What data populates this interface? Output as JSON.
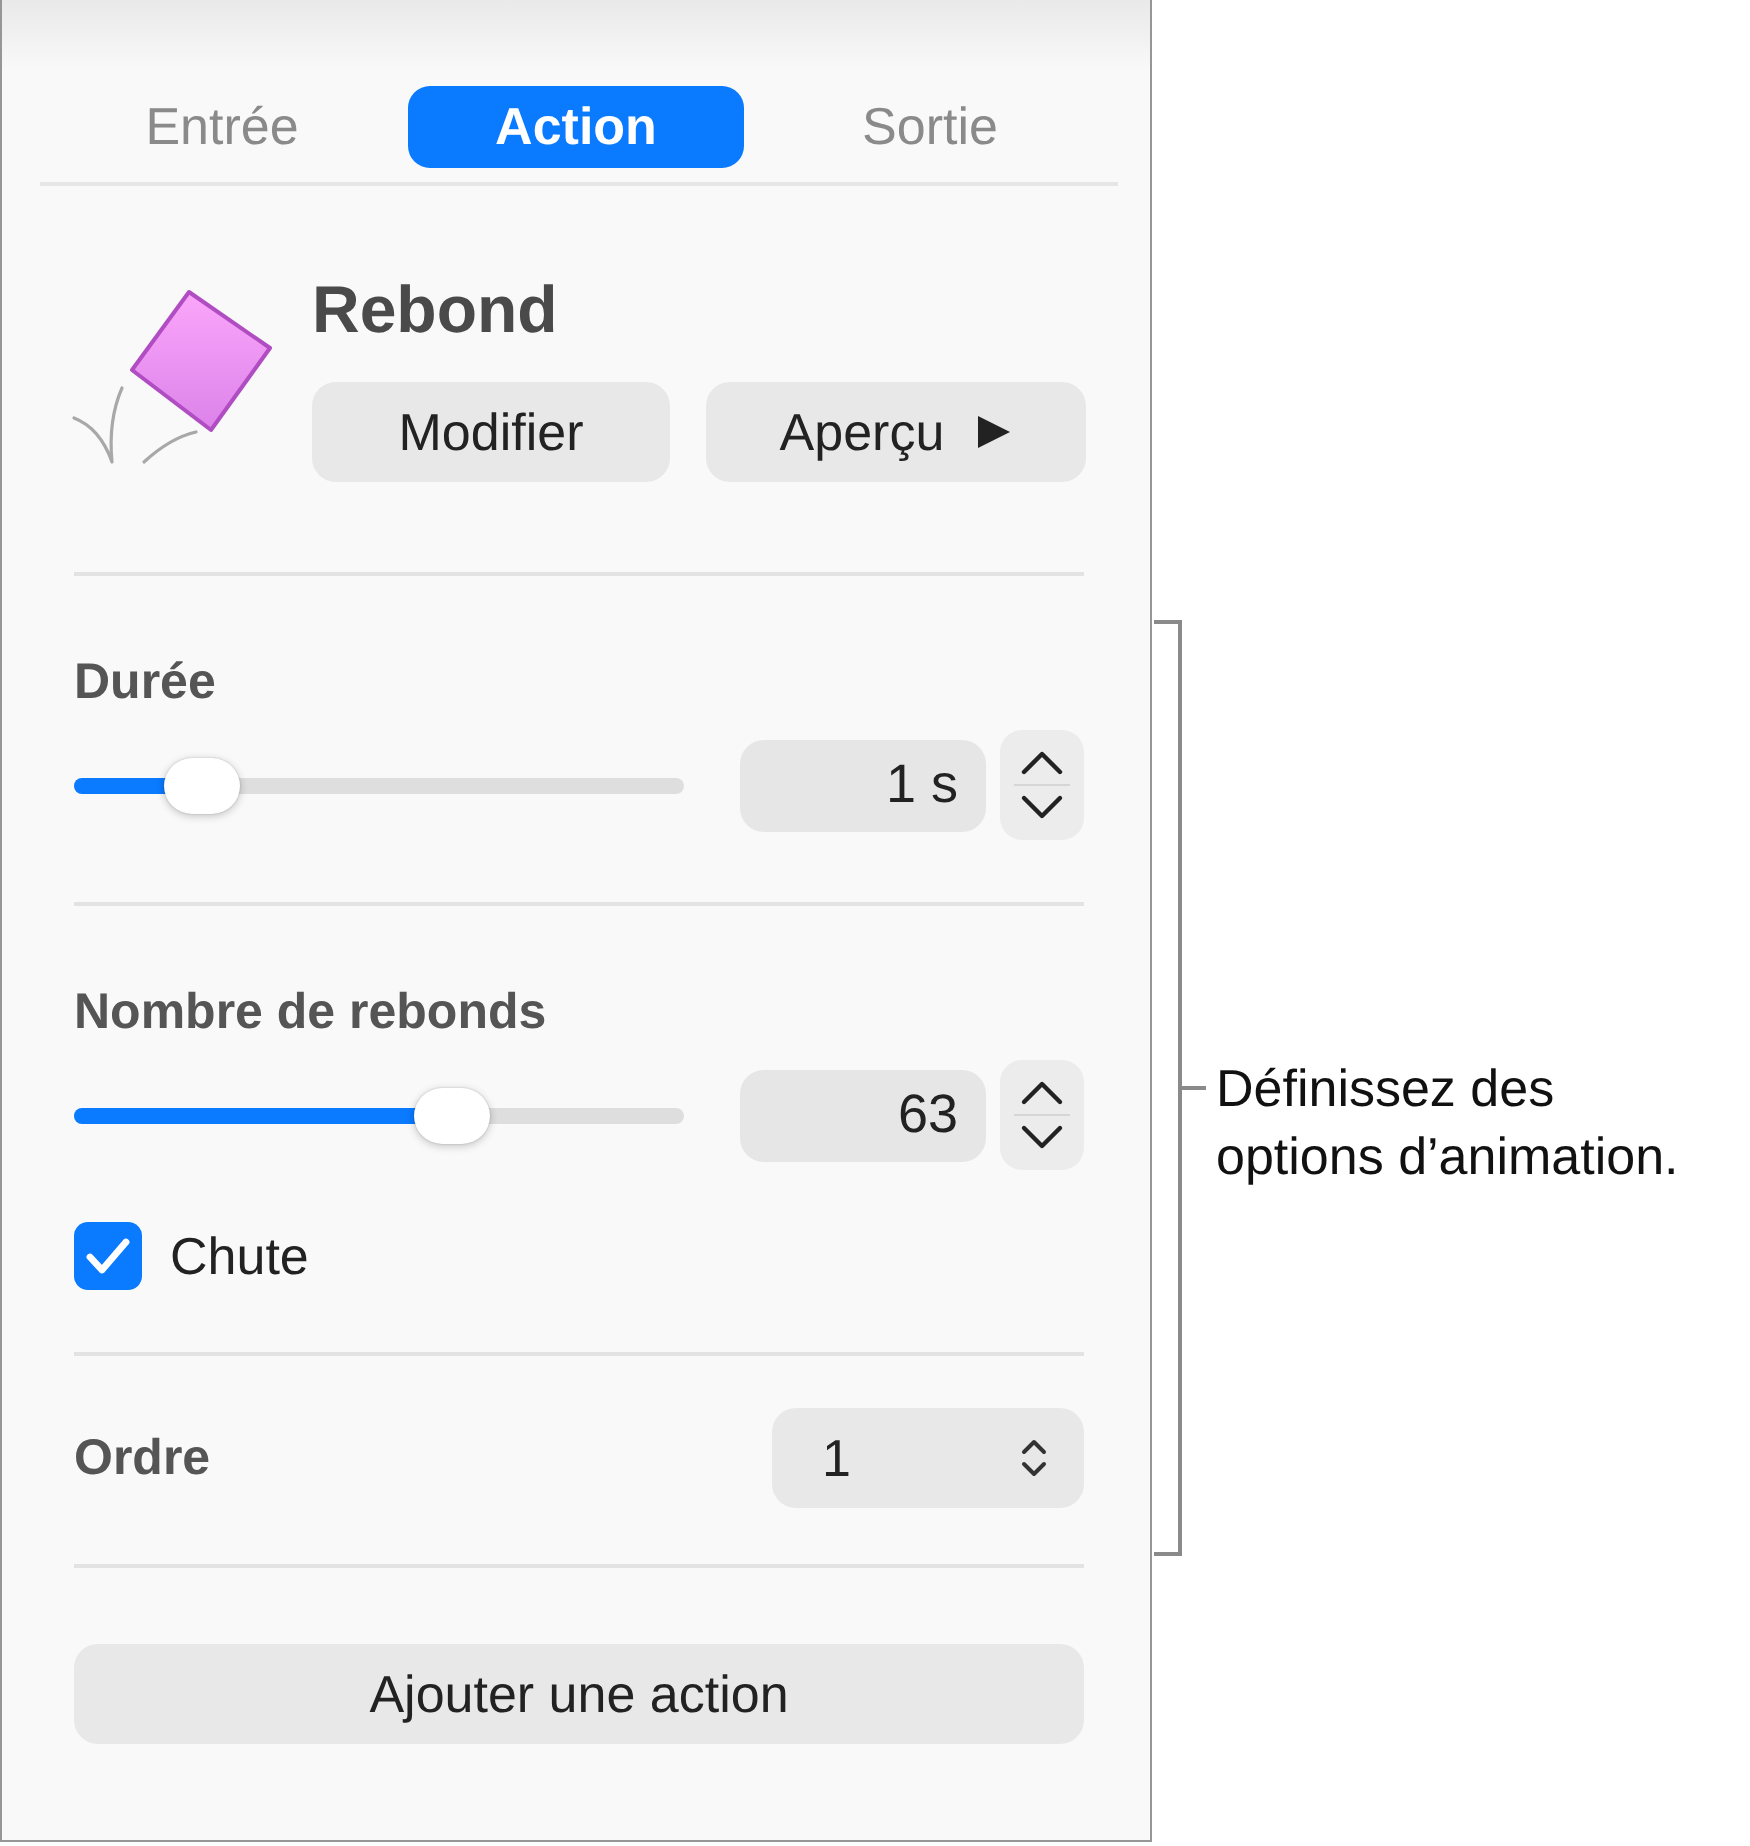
{
  "tabs": [
    {
      "label": "Entrée",
      "selected": false
    },
    {
      "label": "Action",
      "selected": true
    },
    {
      "label": "Sortie",
      "selected": false
    }
  ],
  "effect": {
    "name": "Rebond",
    "buttons": [
      {
        "label": "Modifier",
        "kind": "text"
      },
      {
        "label": "Aperçu",
        "kind": "play"
      }
    ]
  },
  "sections": [
    {
      "kind": "slider",
      "label": "Durée",
      "level": 0.21,
      "value": "1 s"
    },
    {
      "kind": "slider",
      "label": "Nombre de rebonds",
      "level": 0.62,
      "value": "63",
      "checkbox": {
        "label": "Chute",
        "checked": true
      }
    },
    {
      "kind": "popup",
      "label": "Ordre",
      "value": "1"
    }
  ],
  "add_button": "Ajouter une action",
  "callout": "Définissez des options d’animation."
}
